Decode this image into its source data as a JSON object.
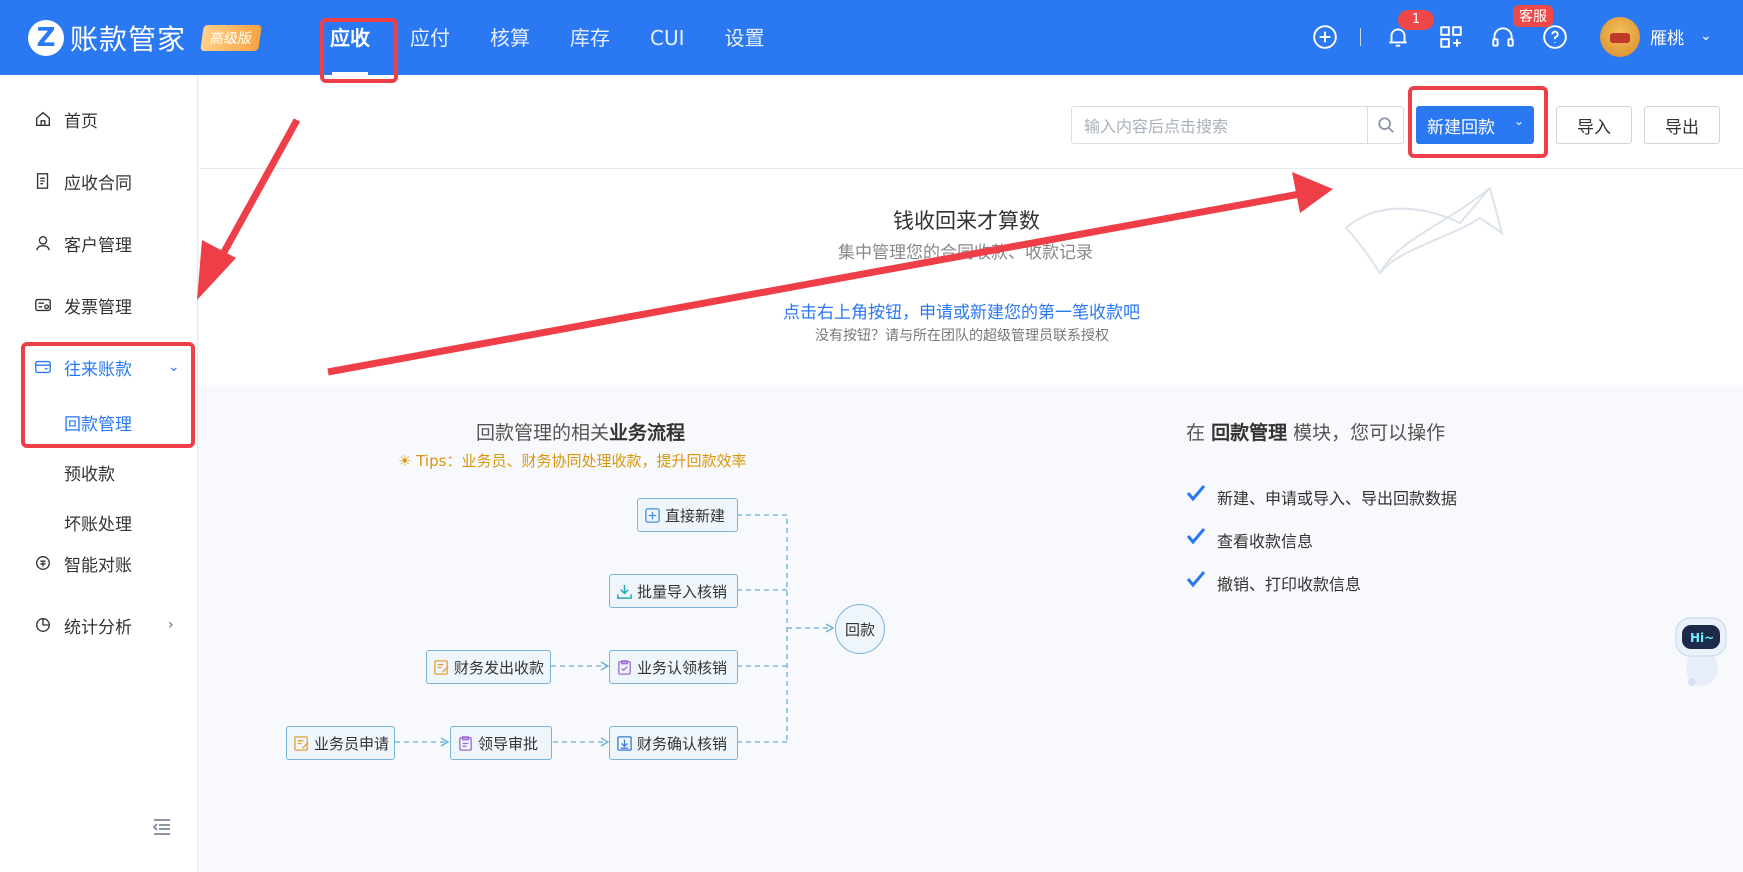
{
  "app": {
    "logo_mark": "Z",
    "name": "账款管家",
    "edition": "高级版"
  },
  "nav": {
    "items": [
      {
        "label": "应收",
        "active": true
      },
      {
        "label": "应付",
        "active": false
      },
      {
        "label": "核算",
        "active": false
      },
      {
        "label": "库存",
        "active": false
      },
      {
        "label": "CUI",
        "active": false
      },
      {
        "label": "设置",
        "active": false
      }
    ]
  },
  "header": {
    "notification_count": "1",
    "service_tag": "客服",
    "username": "雁桃",
    "icons": [
      "add-icon",
      "bell-icon",
      "apps-icon",
      "headset-icon",
      "help-icon"
    ]
  },
  "sidebar": {
    "items": [
      {
        "label": "首页",
        "icon": "home-icon"
      },
      {
        "label": "应收合同",
        "icon": "contract-icon"
      },
      {
        "label": "客户管理",
        "icon": "customer-icon"
      },
      {
        "label": "发票管理",
        "icon": "invoice-icon"
      },
      {
        "label": "往来账款",
        "icon": "account-icon",
        "expanded": true
      },
      {
        "label": "智能对账",
        "icon": "reconcile-icon"
      },
      {
        "label": "统计分析",
        "icon": "chart-icon"
      }
    ],
    "subitems": [
      {
        "label": "回款管理",
        "active": true
      },
      {
        "label": "预收款",
        "active": false
      },
      {
        "label": "坏账处理",
        "active": false
      }
    ]
  },
  "toolbar": {
    "search_placeholder": "输入内容后点击搜索",
    "new_button": "新建回款",
    "import_button": "导入",
    "export_button": "导出"
  },
  "empty_state": {
    "title": "钱收回来才算数",
    "subtitle": "集中管理您的合同收款、收款记录",
    "link": "点击右上角按钮，申请或新建您的第一笔收款吧",
    "note": "没有按钮？请与所在团队的超级管理员联系授权"
  },
  "flow": {
    "title_prefix": "回款管理的相关",
    "title_bold": "业务流程",
    "tips": "Tips：业务员、财务协同处理收款，提升回款效率",
    "nodes": {
      "direct_new": "直接新建",
      "batch_import": "批量导入核销",
      "finance_issue": "财务发出收款",
      "biz_claim": "业务认领核销",
      "sales_apply": "业务员申请",
      "leader_approve": "领导审批",
      "finance_confirm": "财务确认核销",
      "end": "回款"
    }
  },
  "operations": {
    "title_prefix": "在",
    "title_bold": "回款管理",
    "title_suffix": "模块，您可以操作",
    "items": [
      "新建、申请或导入、导出回款数据",
      "查看收款信息",
      "撤销、打印收款信息"
    ]
  },
  "robot": {
    "label": "Hi~"
  },
  "colors": {
    "brand_blue": "#2a78f2",
    "annotation_red": "#ee3f48",
    "tips_orange": "#d9960a"
  }
}
